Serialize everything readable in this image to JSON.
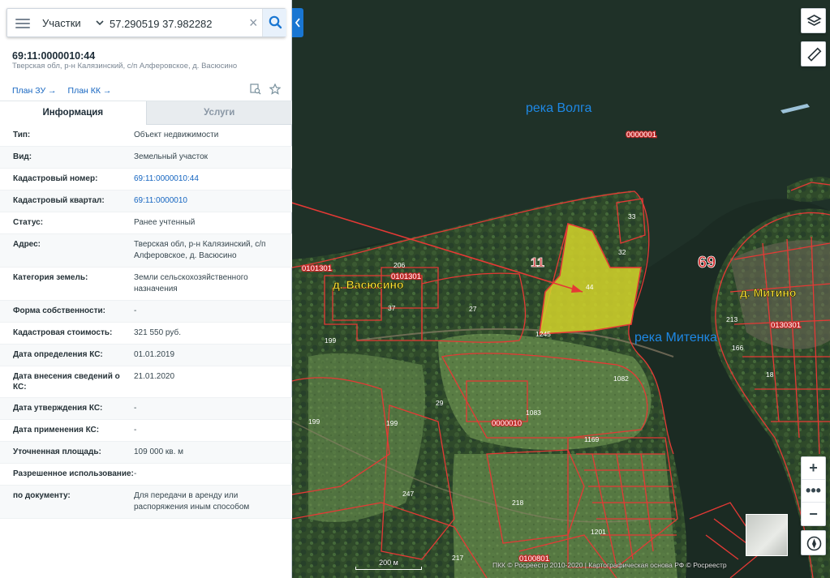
{
  "search": {
    "category": "Участки",
    "query": "57.290519 37.982282"
  },
  "object": {
    "number": "69:11:0000010:44",
    "address": "Тверская обл, р-н Калязинский, с/п Алферовское, д. Васюсино",
    "plan_zu": "План ЗУ →",
    "plan_kk": "План КК →"
  },
  "tabs": {
    "info": "Информация",
    "services": "Услуги"
  },
  "info_rows": [
    {
      "label": "Тип:",
      "value": "Объект недвижимости"
    },
    {
      "label": "Вид:",
      "value": "Земельный участок"
    },
    {
      "label": "Кадастровый номер:",
      "value": "69:11:0000010:44"
    },
    {
      "label": "Кадастровый квартал:",
      "value": "69:11:0000010"
    },
    {
      "label": "Статус:",
      "value": "Ранее учтенный"
    },
    {
      "label": "Адрес:",
      "value": "Тверская обл, р-н Калязинский, с/п Алферовское, д. Васюсино"
    },
    {
      "label": "Категория земель:",
      "value": "Земли сельскохозяйственного назначения"
    },
    {
      "label": "Форма собственности:",
      "value": "-"
    },
    {
      "label": "Кадастровая стоимость:",
      "value": "321 550 руб."
    },
    {
      "label": "Дата определения КС:",
      "value": "01.01.2019"
    },
    {
      "label": "Дата внесения сведений о КС:",
      "value": "21.01.2020"
    },
    {
      "label": "Дата утверждения КС:",
      "value": "-"
    },
    {
      "label": "Дата применения КС:",
      "value": "-"
    },
    {
      "label": "Уточненная площадь:",
      "value": "109 000 кв. м"
    },
    {
      "label": "Разрешенное использование:",
      "value": "-"
    },
    {
      "label": "по документу:",
      "value": "Для передачи в аренду или распоряжения иным способом"
    }
  ],
  "map": {
    "labels": {
      "volga": "река Волга",
      "mitenka": "река Митенка",
      "vasyusino": "д. Васюсино",
      "mitino": "д. Митино",
      "region_69": "69",
      "district_11": "11"
    },
    "codes": [
      "0000001",
      "0101301",
      "0101301",
      "0130301",
      "0000010",
      "0100801"
    ],
    "parcels": [
      "44",
      "33",
      "32",
      "206",
      "37",
      "27",
      "1245",
      "199",
      "199",
      "29",
      "199",
      "1083",
      "1082",
      "1169",
      "247",
      "218",
      "217",
      "1201",
      "213",
      "166",
      "18"
    ],
    "scale": "200 м",
    "copyright": "ПКК © Росреестр 2010-2020 | Картографическая основа РФ © Росреестр"
  },
  "colors": {
    "accent": "#1976d2",
    "parcel_border": "#e53935",
    "selected_parcel": "#d4d42a"
  }
}
